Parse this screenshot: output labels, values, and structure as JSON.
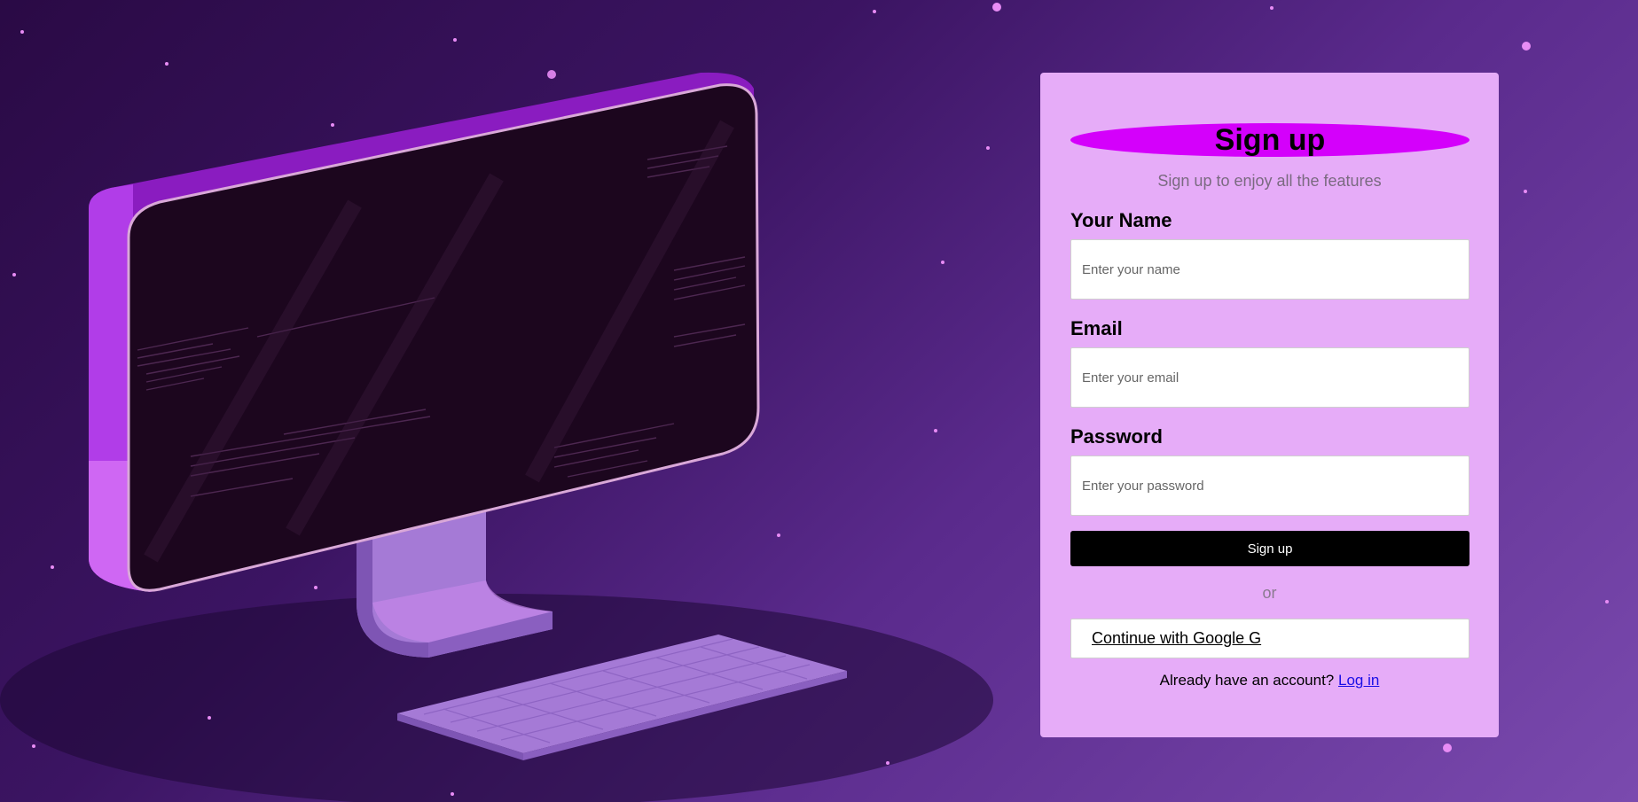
{
  "form": {
    "title": "Sign up",
    "subtitle": "Sign up to enjoy all the features",
    "name_label": "Your Name",
    "name_placeholder": "Enter your name",
    "name_value": "",
    "email_label": "Email",
    "email_placeholder": "Enter your email",
    "email_value": "",
    "password_label": "Password",
    "password_placeholder": "Enter your password",
    "password_value": "",
    "submit_label": "Sign up",
    "divider_text": "or",
    "google_label": "Continue with Google G",
    "login_prompt": "Already have an account?",
    "login_link": "Log in"
  },
  "illustration": {
    "icon": "computer-monitor-keyboard-illustration"
  },
  "colors": {
    "card_background": "#e6acf8",
    "title_pill": "#d400fb",
    "submit_button": "#000000",
    "link": "#1a0ee6",
    "page_gradient_start": "#2a0a45",
    "page_gradient_end": "#7a4aae"
  }
}
